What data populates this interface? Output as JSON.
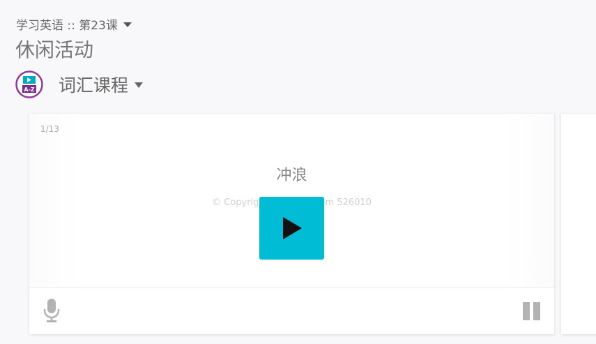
{
  "breadcrumb": {
    "label": "学习英语 :: 第23课"
  },
  "page": {
    "title": "休闲活动"
  },
  "course": {
    "label": "词汇课程",
    "logo_text": "A-Z"
  },
  "card": {
    "counter": "1/13",
    "word": "冲浪",
    "watermark": "© Copyright LingoHut.com 526010"
  },
  "colors": {
    "accent": "#00bcd4",
    "logo_ring": "#8e3a9d",
    "icon_gray": "#b3b3b3"
  },
  "icons": {
    "play": "play-icon",
    "mic": "microphone-icon",
    "pause": "pause-icon",
    "dropdown": "chevron-down-icon"
  }
}
